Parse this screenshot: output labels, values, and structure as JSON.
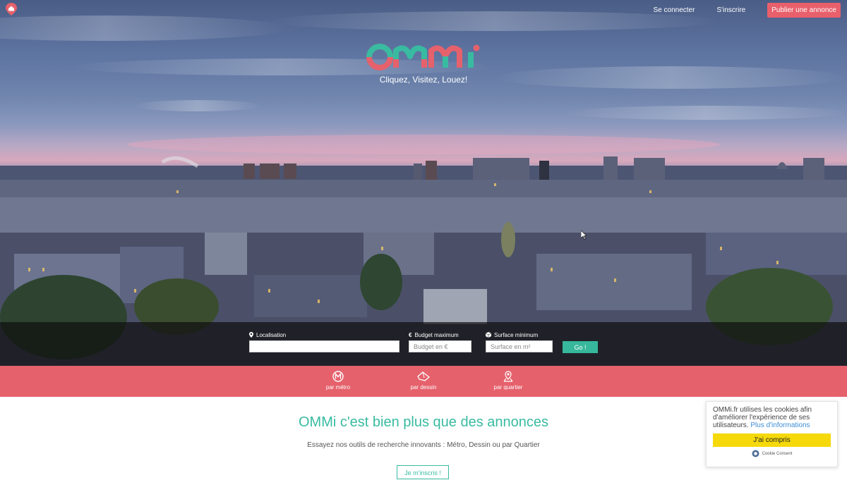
{
  "nav": {
    "login": "Se connecter",
    "signup": "S'inscrire",
    "publish": "Publier une annonce"
  },
  "hero": {
    "brand": "OMMI",
    "tagline": "Cliquez, Visitez, Louez!"
  },
  "search": {
    "location_label": "Localisation",
    "location_value": "",
    "budget_label": "Budget maximum",
    "budget_placeholder": "Budget en €",
    "surface_label": "Surface minimum",
    "surface_placeholder": "Surface en m²",
    "go_label": "Go !"
  },
  "tools": [
    {
      "label": "par métro",
      "icon": "metro-icon"
    },
    {
      "label": "par dessin",
      "icon": "draw-icon"
    },
    {
      "label": "par quartier",
      "icon": "map-pin-icon"
    }
  ],
  "content": {
    "headline": "OMMi c'est bien plus que des annonces",
    "subtitle": "Essayez nos outils de recherche innovants : Métro, Dessin ou par Quartier",
    "signup_button": "Je m'inscris !"
  },
  "cookie": {
    "message": "OMMi.fr utilises les cookies afin d'améliorer l'expérience de ses utilisateurs.",
    "more": "Plus d'informations",
    "accept": "J'ai compris",
    "footer": "Cookie Consent"
  },
  "colors": {
    "accent_red": "#e5616c",
    "accent_green": "#39bba1",
    "cookie_yellow": "#f5d90a"
  }
}
